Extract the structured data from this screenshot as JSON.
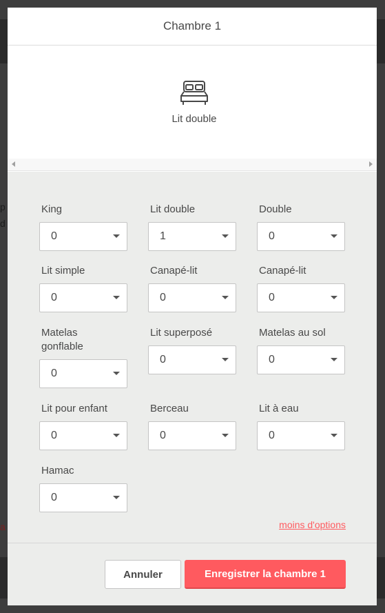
{
  "modal": {
    "title": "Chambre 1",
    "icon": "double-bed-icon",
    "bed_card_label": "Lit double"
  },
  "bed_options": [
    {
      "label": "King",
      "value": "0"
    },
    {
      "label": "Lit double",
      "value": "1"
    },
    {
      "label": "Double",
      "value": "0"
    },
    {
      "label": "Lit simple",
      "value": "0"
    },
    {
      "label": "Canapé-lit",
      "value": "0"
    },
    {
      "label": "Canapé-lit",
      "value": "0"
    },
    {
      "label": "Matelas gonflable",
      "value": "0"
    },
    {
      "label": "Lit superposé",
      "value": "0"
    },
    {
      "label": "Matelas au sol",
      "value": "0"
    },
    {
      "label": "Lit pour enfant",
      "value": "0"
    },
    {
      "label": "Berceau",
      "value": "0"
    },
    {
      "label": "Lit à eau",
      "value": "0"
    },
    {
      "label": "Hamac",
      "value": "0"
    }
  ],
  "less_options_link": "moins d'options",
  "footer": {
    "cancel_label": "Annuler",
    "save_label": "Enregistrer la chambre 1"
  },
  "colors": {
    "accent": "#ff5a5f",
    "panel_bg": "#ecedeb",
    "overlay": "#3d3d3d"
  }
}
